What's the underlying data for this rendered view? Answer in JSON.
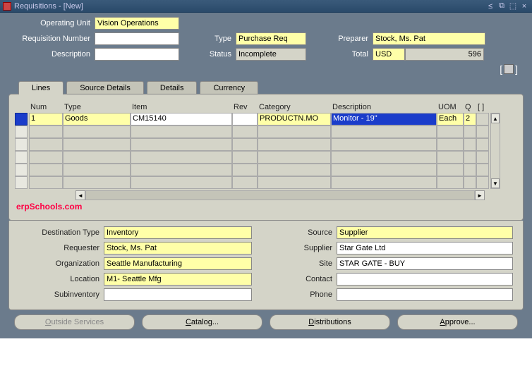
{
  "window": {
    "title": "Requisitions - [New]"
  },
  "header": {
    "operating_unit_label": "Operating Unit",
    "operating_unit": "Vision Operations",
    "req_number_label": "Requisition Number",
    "req_number": "",
    "type_label": "Type",
    "type": "Purchase Req",
    "preparer_label": "Preparer",
    "preparer": "Stock, Ms. Pat",
    "description_label": "Description",
    "description": "",
    "status_label": "Status",
    "status": "Incomplete",
    "total_label": "Total",
    "total_curr": "USD",
    "total_amount": "596"
  },
  "tabs": [
    "Lines",
    "Source Details",
    "Details",
    "Currency"
  ],
  "grid": {
    "headers": {
      "num": "Num",
      "type": "Type",
      "item": "Item",
      "rev": "Rev",
      "category": "Category",
      "description": "Description",
      "uom": "UOM",
      "q": "Q",
      "br": "[  ]"
    },
    "row": {
      "num": "1",
      "type": "Goods",
      "item": "CM15140",
      "rev": "",
      "category": "PRODUCTN.MO",
      "description": "Monitor - 19\"",
      "uom": "Each",
      "q": "2"
    }
  },
  "watermark": "erpSchools.com",
  "detail": {
    "left": {
      "dest_type_label": "Destination Type",
      "dest_type": "Inventory",
      "requester_label": "Requester",
      "requester": "Stock, Ms. Pat",
      "org_label": "Organization",
      "org": "Seattle Manufacturing",
      "location_label": "Location",
      "location": "M1- Seattle Mfg",
      "subinv_label": "Subinventory",
      "subinv": ""
    },
    "right": {
      "source_label": "Source",
      "source": "Supplier",
      "supplier_label": "Supplier",
      "supplier": "Star Gate Ltd",
      "site_label": "Site",
      "site": "STAR GATE - BUY",
      "contact_label": "Contact",
      "contact": "",
      "phone_label": "Phone",
      "phone": ""
    }
  },
  "buttons": {
    "outside_services": "Outside Services",
    "catalog": "Catalog...",
    "distributions": "Distributions",
    "approve": "Approve..."
  }
}
